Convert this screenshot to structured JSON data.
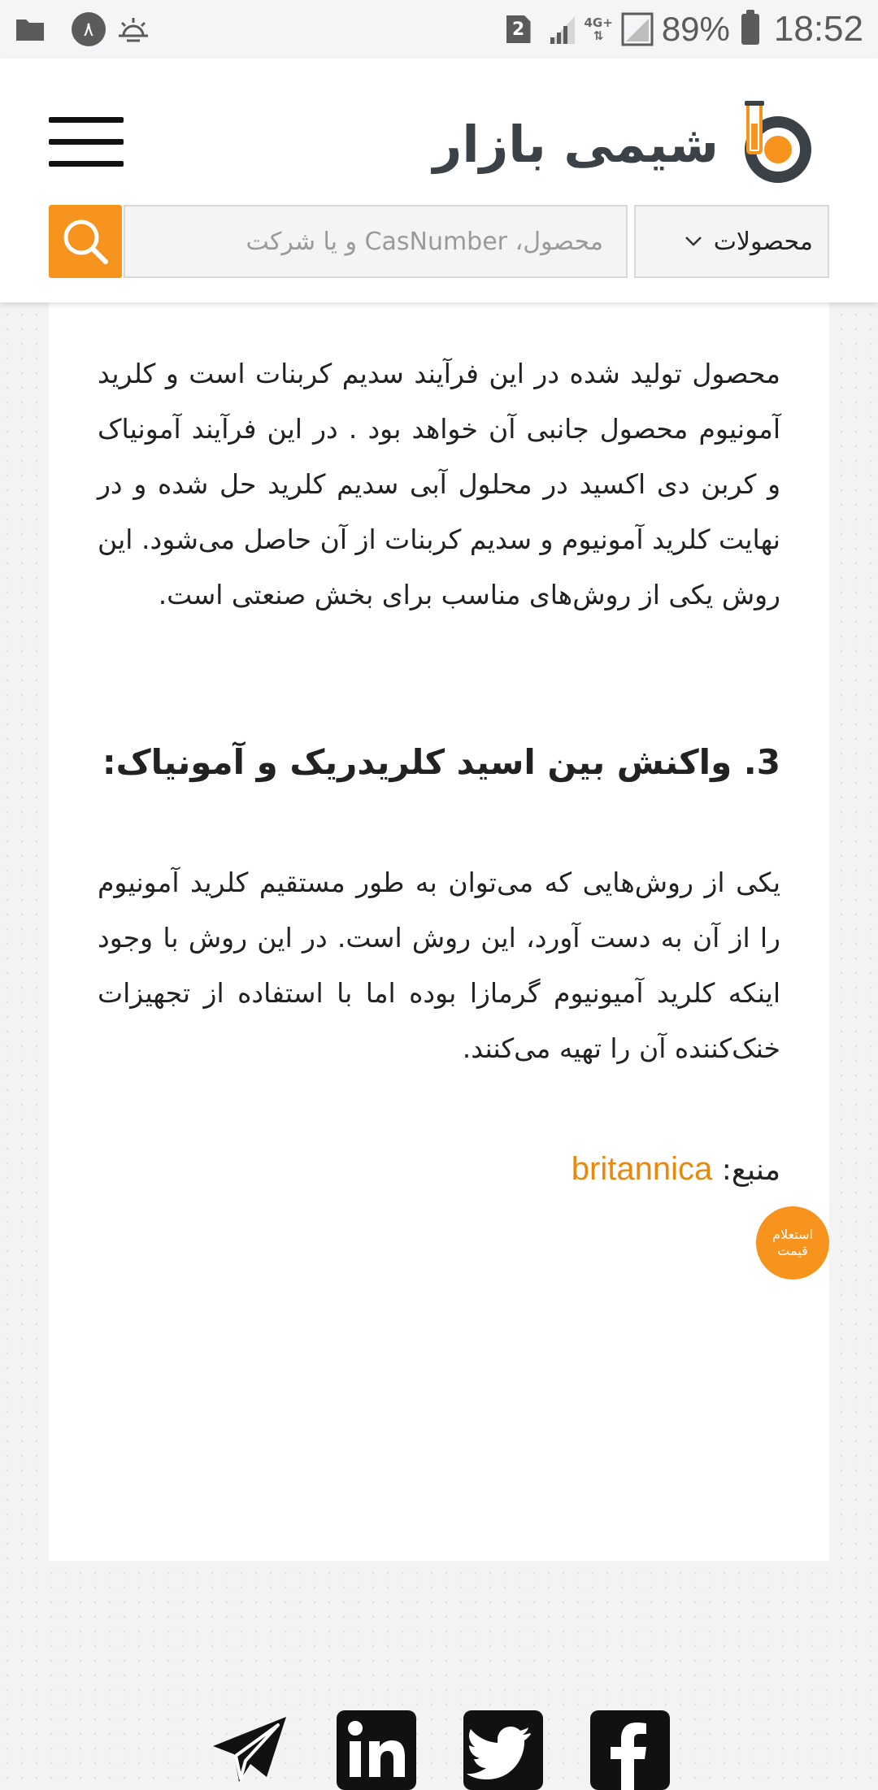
{
  "status_bar": {
    "notification_count": "٨",
    "sim_slot": "2",
    "network_type": "4G+",
    "battery_percent": "89%",
    "time": "18:52"
  },
  "header": {
    "brand_name": "شیمی بازار",
    "search": {
      "placeholder": "محصول، CasNumber و یا شرکت",
      "category_selected": "محصولات"
    }
  },
  "article": {
    "paragraph_1": "محصول تولید شده در این فرآیند سدیم کربنات است و کلرید آمونیوم محصول جانبی آن خواهد بود . در این فرآیند آمونیاک و کربن دی اکسید در محلول آبی سدیم کلرید حل شده و در نهایت کلرید آمونیوم و سدیم کربنات از آن حاصل می‌شود. این روش یکی از روش‌های مناسب برای بخش صنعتی است.",
    "heading_3": "3. واکنش بین اسید کلریدریک و آمونیاک:",
    "paragraph_2": "یکی از روش‌هایی که می‌توان به طور مستقیم کلرید آمونیوم را از آن به دست آورد، این روش است. در این روش با وجود اینکه کلرید آمیونیوم گرمازا بوده اما با استفاده از تجهیزات خنک‌کننده آن را تهیه می‌کنند.",
    "source_label": "منبع:",
    "source_link": "britannica"
  },
  "price_inquiry_button": {
    "line_1": "استعلام",
    "line_2": "قیمت"
  },
  "social_icons": [
    "telegram-icon",
    "linkedin-icon",
    "twitter-icon",
    "facebook-icon"
  ],
  "colors": {
    "accent": "#f7941d",
    "link": "#e8890f",
    "brand_dark": "#3b4247"
  }
}
